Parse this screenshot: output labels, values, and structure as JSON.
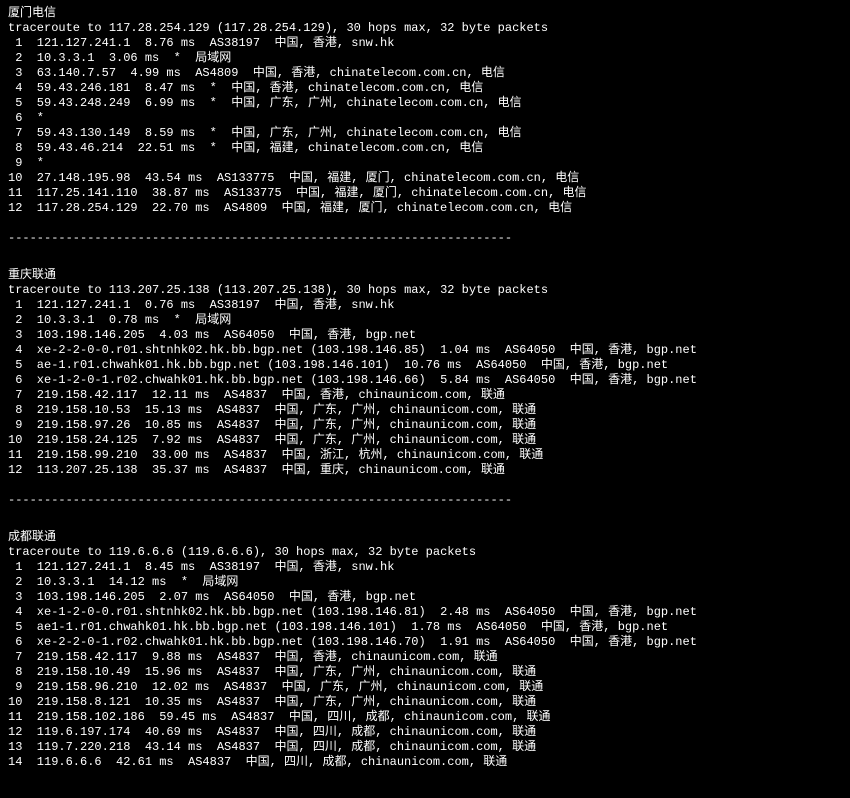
{
  "blocks": [
    {
      "title": "厦门电信",
      "trace_header": "traceroute to 117.28.254.129 (117.28.254.129), 30 hops max, 32 byte packets",
      "hops": [
        {
          "n": " 1",
          "ip": "121.127.241.1",
          "ms": "8.76 ms",
          "asn": "AS38197",
          "loc": "中国, 香港, snw.hk"
        },
        {
          "n": " 2",
          "ip": "10.3.3.1",
          "ms": "3.06 ms",
          "asn": "*",
          "loc": "局域网"
        },
        {
          "n": " 3",
          "ip": "63.140.7.57",
          "ms": "4.99 ms",
          "asn": "AS4809",
          "loc": "中国, 香港, chinatelecom.com.cn, 电信"
        },
        {
          "n": " 4",
          "ip": "59.43.246.181",
          "ms": "8.47 ms",
          "asn": "*",
          "loc": "中国, 香港, chinatelecom.com.cn, 电信"
        },
        {
          "n": " 5",
          "ip": "59.43.248.249",
          "ms": "6.99 ms",
          "asn": "*",
          "loc": "中国, 广东, 广州, chinatelecom.com.cn, 电信"
        },
        {
          "n": " 6",
          "ip": "*",
          "ms": "",
          "asn": "",
          "loc": ""
        },
        {
          "n": " 7",
          "ip": "59.43.130.149",
          "ms": "8.59 ms",
          "asn": "*",
          "loc": "中国, 广东, 广州, chinatelecom.com.cn, 电信"
        },
        {
          "n": " 8",
          "ip": "59.43.46.214",
          "ms": "22.51 ms",
          "asn": "*",
          "loc": "中国, 福建, chinatelecom.com.cn, 电信"
        },
        {
          "n": " 9",
          "ip": "*",
          "ms": "",
          "asn": "",
          "loc": ""
        },
        {
          "n": "10",
          "ip": "27.148.195.98",
          "ms": "43.54 ms",
          "asn": "AS133775",
          "loc": "中国, 福建, 厦门, chinatelecom.com.cn, 电信"
        },
        {
          "n": "11",
          "ip": "117.25.141.110",
          "ms": "38.87 ms",
          "asn": "AS133775",
          "loc": "中国, 福建, 厦门, chinatelecom.com.cn, 电信"
        },
        {
          "n": "12",
          "ip": "117.28.254.129",
          "ms": "22.70 ms",
          "asn": "AS4809",
          "loc": "中国, 福建, 厦门, chinatelecom.com.cn, 电信"
        }
      ]
    },
    {
      "title": "重庆联通",
      "trace_header": "traceroute to 113.207.25.138 (113.207.25.138), 30 hops max, 32 byte packets",
      "hops": [
        {
          "n": " 1",
          "ip": "121.127.241.1",
          "ms": "0.76 ms",
          "asn": "AS38197",
          "loc": "中国, 香港, snw.hk"
        },
        {
          "n": " 2",
          "ip": "10.3.3.1",
          "ms": "0.78 ms",
          "asn": "*",
          "loc": "局域网"
        },
        {
          "n": " 3",
          "ip": "103.198.146.205",
          "ms": "4.03 ms",
          "asn": "AS64050",
          "loc": "中国, 香港, bgp.net"
        },
        {
          "n": " 4",
          "ip": "xe-2-2-0-0.r01.shtnhk02.hk.bb.bgp.net (103.198.146.85)",
          "ms": "1.04 ms",
          "asn": "AS64050",
          "loc": "中国, 香港, bgp.net"
        },
        {
          "n": " 5",
          "ip": "ae-1.r01.chwahk01.hk.bb.bgp.net (103.198.146.101)",
          "ms": "10.76 ms",
          "asn": "AS64050",
          "loc": "中国, 香港, bgp.net"
        },
        {
          "n": " 6",
          "ip": "xe-1-2-0-1.r02.chwahk01.hk.bb.bgp.net (103.198.146.66)",
          "ms": "5.84 ms",
          "asn": "AS64050",
          "loc": "中国, 香港, bgp.net"
        },
        {
          "n": " 7",
          "ip": "219.158.42.117",
          "ms": "12.11 ms",
          "asn": "AS4837",
          "loc": "中国, 香港, chinaunicom.com, 联通"
        },
        {
          "n": " 8",
          "ip": "219.158.10.53",
          "ms": "15.13 ms",
          "asn": "AS4837",
          "loc": "中国, 广东, 广州, chinaunicom.com, 联通"
        },
        {
          "n": " 9",
          "ip": "219.158.97.26",
          "ms": "10.85 ms",
          "asn": "AS4837",
          "loc": "中国, 广东, 广州, chinaunicom.com, 联通"
        },
        {
          "n": "10",
          "ip": "219.158.24.125",
          "ms": "7.92 ms",
          "asn": "AS4837",
          "loc": "中国, 广东, 广州, chinaunicom.com, 联通"
        },
        {
          "n": "11",
          "ip": "219.158.99.210",
          "ms": "33.00 ms",
          "asn": "AS4837",
          "loc": "中国, 浙江, 杭州, chinaunicom.com, 联通"
        },
        {
          "n": "12",
          "ip": "113.207.25.138",
          "ms": "35.37 ms",
          "asn": "AS4837",
          "loc": "中国, 重庆, chinaunicom.com, 联通"
        }
      ]
    },
    {
      "title": "成都联通",
      "trace_header": "traceroute to 119.6.6.6 (119.6.6.6), 30 hops max, 32 byte packets",
      "hops": [
        {
          "n": " 1",
          "ip": "121.127.241.1",
          "ms": "8.45 ms",
          "asn": "AS38197",
          "loc": "中国, 香港, snw.hk"
        },
        {
          "n": " 2",
          "ip": "10.3.3.1",
          "ms": "14.12 ms",
          "asn": "*",
          "loc": "局域网"
        },
        {
          "n": " 3",
          "ip": "103.198.146.205",
          "ms": "2.07 ms",
          "asn": "AS64050",
          "loc": "中国, 香港, bgp.net"
        },
        {
          "n": " 4",
          "ip": "xe-1-2-0-0.r01.shtnhk02.hk.bb.bgp.net (103.198.146.81)",
          "ms": "2.48 ms",
          "asn": "AS64050",
          "loc": "中国, 香港, bgp.net"
        },
        {
          "n": " 5",
          "ip": "ae1-1.r01.chwahk01.hk.bb.bgp.net (103.198.146.101)",
          "ms": "1.78 ms",
          "asn": "AS64050",
          "loc": "中国, 香港, bgp.net"
        },
        {
          "n": " 6",
          "ip": "xe-2-2-0-1.r02.chwahk01.hk.bb.bgp.net (103.198.146.70)",
          "ms": "1.91 ms",
          "asn": "AS64050",
          "loc": "中国, 香港, bgp.net"
        },
        {
          "n": " 7",
          "ip": "219.158.42.117",
          "ms": "9.88 ms",
          "asn": "AS4837",
          "loc": "中国, 香港, chinaunicom.com, 联通"
        },
        {
          "n": " 8",
          "ip": "219.158.10.49",
          "ms": "15.96 ms",
          "asn": "AS4837",
          "loc": "中国, 广东, 广州, chinaunicom.com, 联通"
        },
        {
          "n": " 9",
          "ip": "219.158.96.210",
          "ms": "12.02 ms",
          "asn": "AS4837",
          "loc": "中国, 广东, 广州, chinaunicom.com, 联通"
        },
        {
          "n": "10",
          "ip": "219.158.8.121",
          "ms": "10.35 ms",
          "asn": "AS4837",
          "loc": "中国, 广东, 广州, chinaunicom.com, 联通"
        },
        {
          "n": "11",
          "ip": "219.158.102.186",
          "ms": "59.45 ms",
          "asn": "AS4837",
          "loc": "中国, 四川, 成都, chinaunicom.com, 联通"
        },
        {
          "n": "12",
          "ip": "119.6.197.174",
          "ms": "40.69 ms",
          "asn": "AS4837",
          "loc": "中国, 四川, 成都, chinaunicom.com, 联通"
        },
        {
          "n": "13",
          "ip": "119.7.220.218",
          "ms": "43.14 ms",
          "asn": "AS4837",
          "loc": "中国, 四川, 成都, chinaunicom.com, 联通"
        },
        {
          "n": "14",
          "ip": "119.6.6.6",
          "ms": "42.61 ms",
          "asn": "AS4837",
          "loc": "中国, 四川, 成都, chinaunicom.com, 联通"
        }
      ]
    }
  ],
  "hr": "----------------------------------------------------------------------"
}
